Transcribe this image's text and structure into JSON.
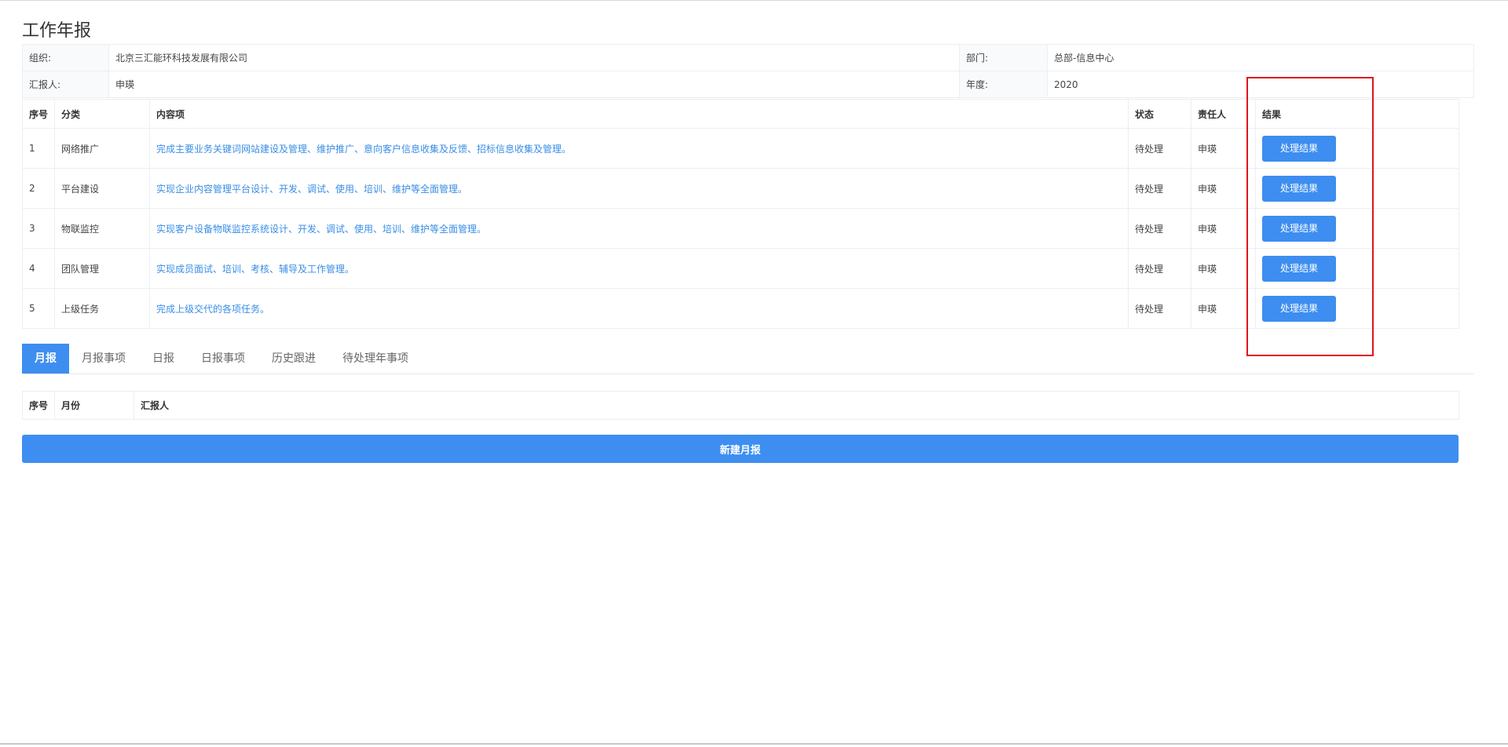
{
  "page": {
    "title": "工作年报"
  },
  "info": {
    "org_label": "组织:",
    "org_value": "北京三汇能环科技发展有限公司",
    "dept_label": "部门:",
    "dept_value": "总部-信息中心",
    "reporter_label": "汇报人:",
    "reporter_value": "申瑛",
    "year_label": "年度:",
    "year_value": "2020"
  },
  "tasks": {
    "headers": {
      "no": "序号",
      "category": "分类",
      "content": "内容项",
      "status": "状态",
      "owner": "责任人",
      "result": "结果"
    },
    "button_label": "处理结果",
    "rows": [
      {
        "no": "1",
        "category": "网络推广",
        "content": "完成主要业务关键词网站建设及管理、维护推广、意向客户信息收集及反馈、招标信息收集及管理。",
        "status": "待处理",
        "owner": "申瑛"
      },
      {
        "no": "2",
        "category": "平台建设",
        "content": "实现企业内容管理平台设计、开发、调试、使用、培训、维护等全面管理。",
        "status": "待处理",
        "owner": "申瑛"
      },
      {
        "no": "3",
        "category": "物联监控",
        "content": "实现客户设备物联监控系统设计、开发、调试、使用、培训、维护等全面管理。",
        "status": "待处理",
        "owner": "申瑛"
      },
      {
        "no": "4",
        "category": "团队管理",
        "content": "实现成员面试、培训、考核、辅导及工作管理。",
        "status": "待处理",
        "owner": "申瑛"
      },
      {
        "no": "5",
        "category": "上级任务",
        "content": "完成上级交代的各项任务。",
        "status": "待处理",
        "owner": "申瑛"
      }
    ]
  },
  "tabs": [
    {
      "label": "月报"
    },
    {
      "label": "月报事项"
    },
    {
      "label": "日报"
    },
    {
      "label": "日报事项"
    },
    {
      "label": "历史跟进"
    },
    {
      "label": "待处理年事项"
    }
  ],
  "months": {
    "headers": {
      "no": "序号",
      "month": "月份",
      "reporter": "汇报人"
    }
  },
  "new_button_label": "新建月报",
  "colors": {
    "primary": "#3d8ef0",
    "link": "#3a8ee6",
    "highlight": "#e0141e"
  }
}
